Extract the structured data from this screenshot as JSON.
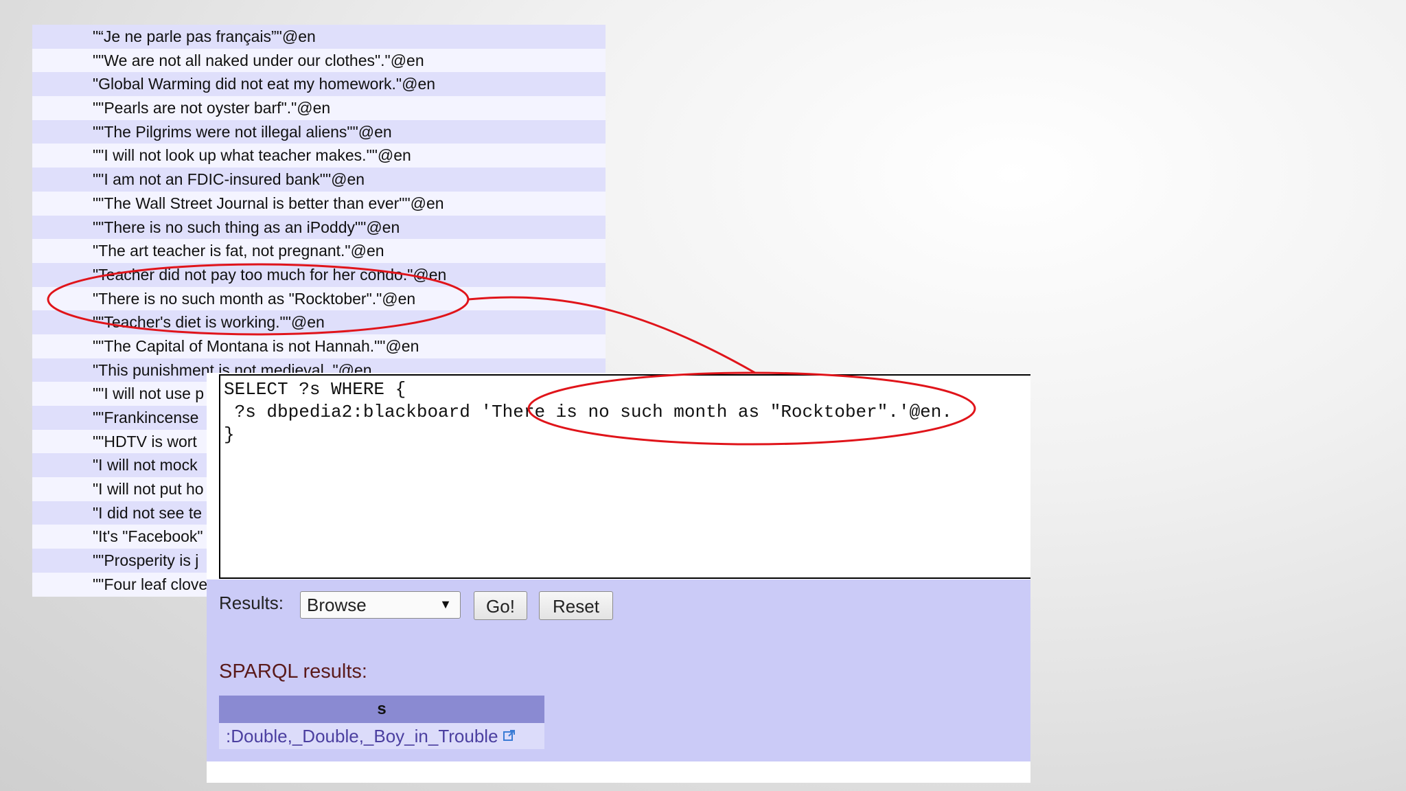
{
  "quote_list": {
    "items": [
      "\"“Je ne parle pas français”\"@en",
      "\"\"We are not all naked under our clothes\".\"@en",
      "\"Global Warming did not eat my homework.\"@en",
      "\"\"Pearls are not oyster barf\".\"@en",
      "\"\"The Pilgrims were not illegal aliens\"\"@en",
      "\"\"I will not look up what teacher makes.\"\"@en",
      "\"\"I am not an FDIC-insured bank\"\"@en",
      "\"\"The Wall Street Journal is better than ever\"\"@en",
      "\"\"There is no such thing as an iPoddy\"\"@en",
      "\"The art teacher is fat, not pregnant.\"@en",
      "\"Teacher did not pay too much for her condo.\"@en",
      "\"There is no such month as \"Rocktober\".\"@en",
      "\"\"Teacher's diet is working.\"\"@en",
      "\"\"The Capital of Montana is not Hannah.\"\"@en",
      "\"This punishment is not medieval. \"@en",
      "\"\"I will not use p",
      "\"\"Frankincense",
      "\"\"HDTV is wort",
      "\"I will not mock",
      "\"I will not put ho",
      "\"I did not see te",
      "\"It's \"Facebook\"",
      "\"\"Prosperity is j",
      "\"\"Four leaf clove"
    ]
  },
  "query_editor": {
    "line1": "SELECT ?s WHERE {",
    "line2": " ?s dbpedia2:blackboard 'There is no such month as \"Rocktober\".'@en.",
    "line3": "}"
  },
  "controls": {
    "results_label": "Results:",
    "results_select_value": "Browse",
    "go_label": "Go!",
    "reset_label": "Reset"
  },
  "results": {
    "heading": "SPARQL results:",
    "column_header": "s",
    "rows": [
      ":Double,_Double,_Boy_in_Trouble"
    ]
  },
  "colors": {
    "annotation": "#e0141a",
    "row_odd": "#dfdffb",
    "row_even": "#f4f4ff",
    "panel_bg": "#cbcbf7",
    "table_header": "#8a8ad2",
    "link": "#4b3fa0"
  },
  "icons": {
    "external_link": "external-link-icon",
    "dropdown": "dropdown-arrow-icon"
  }
}
